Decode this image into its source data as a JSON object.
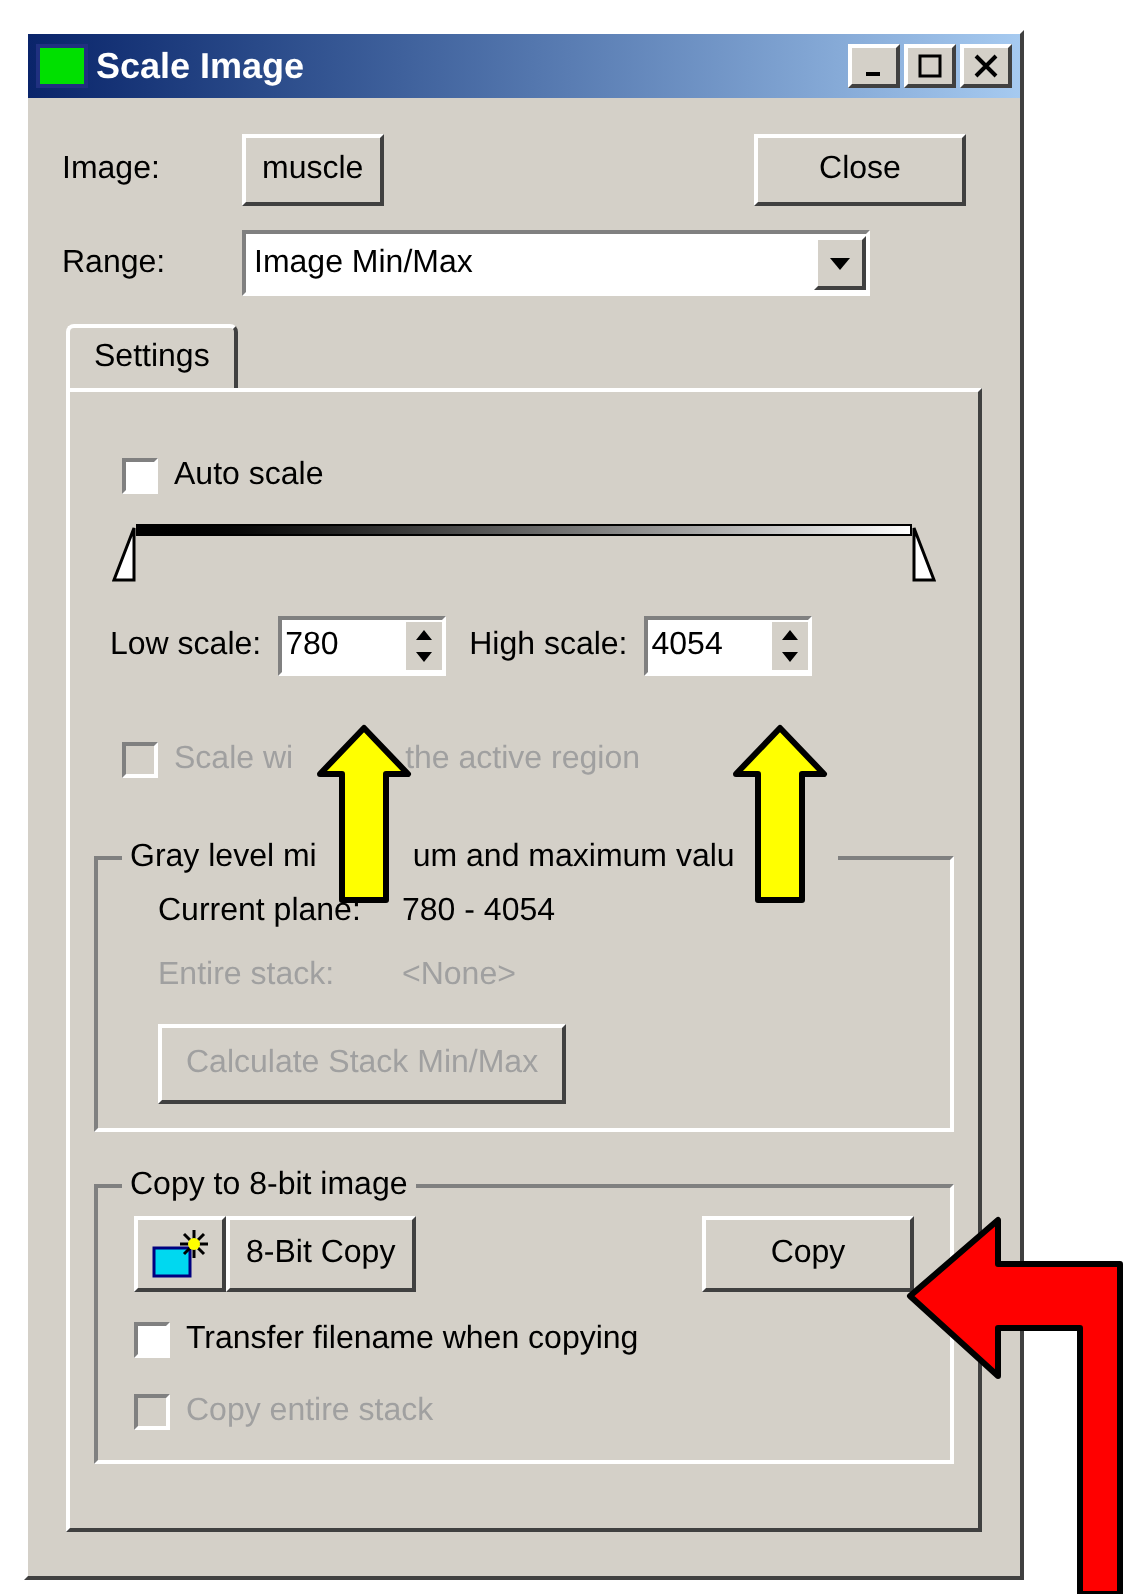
{
  "window": {
    "title": "Scale Image"
  },
  "image": {
    "label": "Image:",
    "button": "muscle"
  },
  "close_button": "Close",
  "range": {
    "label": "Range:",
    "value": "Image Min/Max"
  },
  "tabs": [
    {
      "label": "Settings",
      "selected": true
    }
  ],
  "auto_scale": {
    "label": "Auto scale",
    "checked": false,
    "disabled": false
  },
  "scale_slider": {
    "low": {
      "level": 0
    },
    "high": {
      "level": 1
    }
  },
  "low_scale": {
    "label": "Low scale:",
    "value": "780"
  },
  "high_scale": {
    "label": "High scale:",
    "value": "4054"
  },
  "scale_within_region": {
    "label_parts": [
      "Scale wi",
      "the active region"
    ],
    "checked": false,
    "disabled": true
  },
  "gray_level_group": {
    "title_parts": [
      "Gray level mi",
      "um and maximum valu"
    ],
    "rows": [
      {
        "label": "Current plane:",
        "value": "780 - 4054",
        "disabled": false
      },
      {
        "label": "Entire stack:",
        "value": "<None>",
        "disabled": true
      }
    ],
    "button": {
      "label": "Calculate Stack Min/Max",
      "disabled": true
    }
  },
  "copy_group": {
    "title": "Copy to 8-bit image",
    "bit_copy_button": "8-Bit Copy",
    "copy_button": "Copy",
    "options": [
      {
        "label": "Transfer filename when copying",
        "checked": false,
        "disabled": false
      },
      {
        "label": "Copy entire stack",
        "checked": false,
        "disabled": true
      }
    ]
  }
}
